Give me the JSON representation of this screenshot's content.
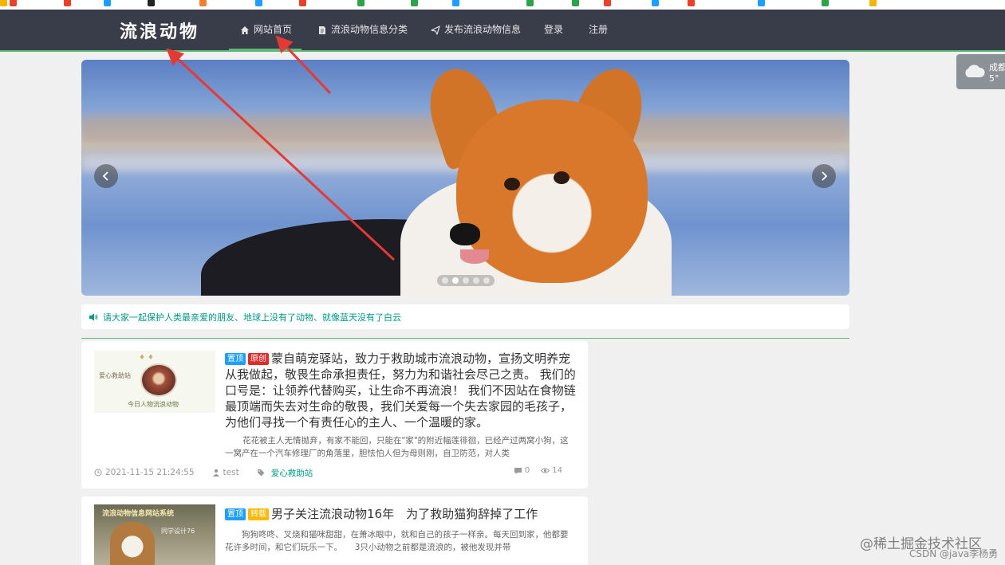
{
  "brand": {
    "logo": "流浪动物"
  },
  "nav": {
    "items": [
      {
        "label": "网站首页",
        "icon": "home-icon",
        "active": true
      },
      {
        "label": "流浪动物信息分类",
        "icon": "document-icon"
      },
      {
        "label": "发布流浪动物信息",
        "icon": "send-icon"
      },
      {
        "label": "登录"
      },
      {
        "label": "注册"
      }
    ]
  },
  "weather": {
    "city": "成都",
    "temp": "5°",
    "icon": "cloud-icon"
  },
  "carousel": {
    "slide_count": 5,
    "active_index": 1,
    "prev_icon": "chevron-left-icon",
    "next_icon": "chevron-right-icon"
  },
  "notice": {
    "icon": "speaker-icon",
    "text": "请大家一起保护人类最亲爱的朋友、地球上没有了动物、就像蓝天没有了白云"
  },
  "posts": [
    {
      "badges": [
        "置顶",
        "原创"
      ],
      "title": "蒙自萌宠驿站，致力于救助城市流浪动物，宣扬文明养宠从我做起，敬畏生命承担责任，努力为和谐社会尽己之责。 我们的口号是：让领养代替购买，让生命不再流浪！ 我们不因站在食物链最顶端而失去对生命的敬畏，我们关爱每一个失去家园的毛孩子，为他们寻找一个有责任心的主人、一个温暖的家。",
      "summary": "花花被主人无情抛弃，有家不能回，只能在\"家\"的附近幅莲徘徊，已经产过两窝小狗，这一窝产在一个汽车修理厂的角落里，胆怯怕人但为母则刚，自卫防范，对人类",
      "date": "2021-11-15 21:24:55",
      "author": "test",
      "category": "爱心救助站",
      "comments": "0",
      "views": "14",
      "thumb_text": [
        "♦ ♦",
        "爱心救助站",
        "今日人物流浪动物"
      ]
    },
    {
      "badges": [
        "置顶",
        "转载"
      ],
      "title": "男子关注流浪动物16年　为了救助猫狗辞掉了工作",
      "summary": "　　狗狗咚咚、叉烧和猫咪甜甜，在萧冰眼中，就和自己的孩子一样亲。每天回到家，他都要花许多时间，和它们玩乐一下。　　3只小动物之前都是流浪的，被他发现并带",
      "thumb_text": [
        "流浪动物信息网站系统",
        "同学设计76"
      ]
    }
  ],
  "watermark": {
    "line1": "@稀土掘金技术社区",
    "line2": "CSDN @java李杨勇"
  },
  "colors": {
    "nav_bg": "#393d49",
    "accent": "#5fb878",
    "teal": "#009688",
    "badge_top": "#1e9fff",
    "badge_orig": "#e02b2b",
    "badge_repost": "#ffb800"
  }
}
